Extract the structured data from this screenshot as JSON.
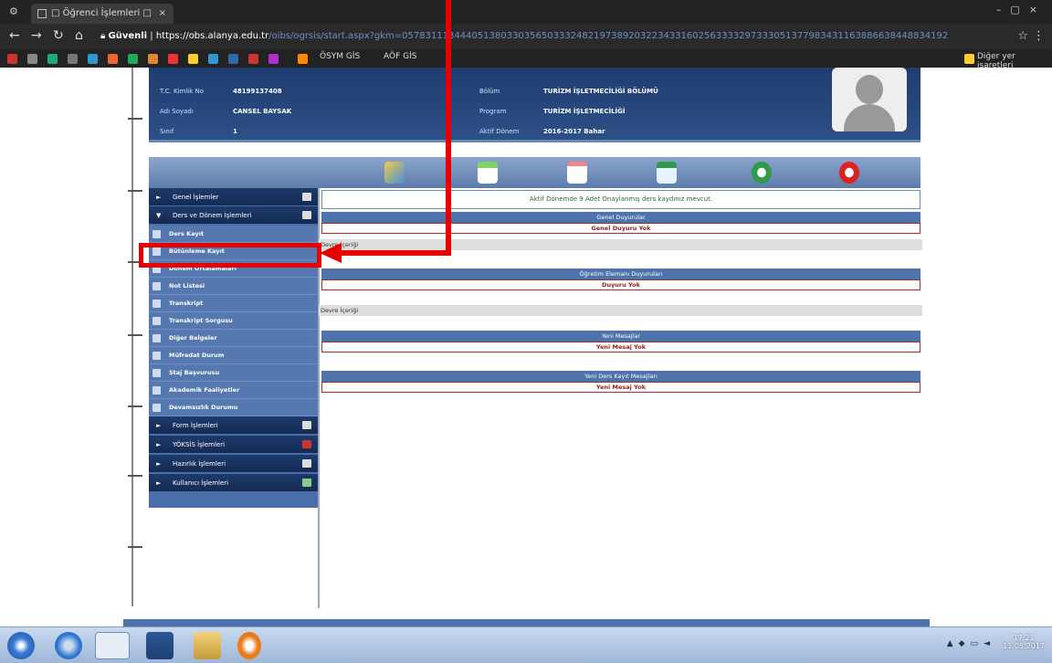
{
  "browser": {
    "tab_title": "□ Öğrenci İşlemleri □",
    "security_label": "Güvenli",
    "url_host": "https://obs.alanya.edu.tr",
    "url_path": "/oibs/ogrsis/start.aspx?gkm=0578311134440513803303565033324821973892032234331602563333297333051377983431163886638448834192",
    "bookmarks": [
      "ÖSYM GİS",
      "AÖF GİS",
      "Diğer yer işaretleri"
    ]
  },
  "student": {
    "rows_left": [
      {
        "label": "T.C. Kimlik No",
        "value": "48199137408"
      },
      {
        "label": "Adı Soyadı",
        "value": "CANSEL BAYSAK"
      },
      {
        "label": "Sınıf",
        "value": "1"
      }
    ],
    "rows_right": [
      {
        "label": "Bölüm",
        "value": "TURİZM İŞLETMECİLİĞİ BÖLÜMÜ"
      },
      {
        "label": "Program",
        "value": "TURİZM İŞLETMECİLİĞİ"
      },
      {
        "label": "Aktif Dönem",
        "value": "2016-2017 Bahar"
      }
    ]
  },
  "sidebar": {
    "sections_top": [
      {
        "label": "Genel İşlemler",
        "expanded": false
      },
      {
        "label": "Ders ve Dönem İşlemleri",
        "expanded": true
      }
    ],
    "items": [
      "Ders Kayıt",
      "Bütünleme Kayıt",
      "Dönem Ortalamaları",
      "Not Listesi",
      "Transkript",
      "Transkript Sorgusu",
      "Diğer Belgeler",
      "Müfredat Durum",
      "Staj Başvurusu",
      "Akademik Faaliyetler",
      "Devamsızlık Durumu"
    ],
    "sections_bottom": [
      "Form İşlemleri",
      "YÖKSİS İşlemleri",
      "Hazırlık İşlemleri",
      "Kullanıcı İşlemleri"
    ]
  },
  "content": {
    "notice": "Aktif Dönemde 9 Adet Onaylanmış ders kaydınız mevcut.",
    "general_header": "Genel Duyurular",
    "general_row": "Genel Duyuru Yok",
    "grey_1": "Devre İçeriği",
    "teacher_header": "Öğretim Elemanı Duyuruları",
    "teacher_row": "Duyuru Yok",
    "grey_2": "Devre İçeriği",
    "new_msg_header": "Yeni Mesajlar",
    "new_msg_row": "Yeni Mesaj Yok",
    "course_msg_header": "Yeni Ders Kayıt Mesajları",
    "course_msg_row": "Yeni Mesaj Yok"
  },
  "taskbar": {
    "time": "17:21",
    "date": "11.05.2017"
  },
  "colors": {
    "annotation": "#e60000",
    "header_blue": "#1f3d70",
    "sidebar_blue": "#4a6fa8"
  }
}
